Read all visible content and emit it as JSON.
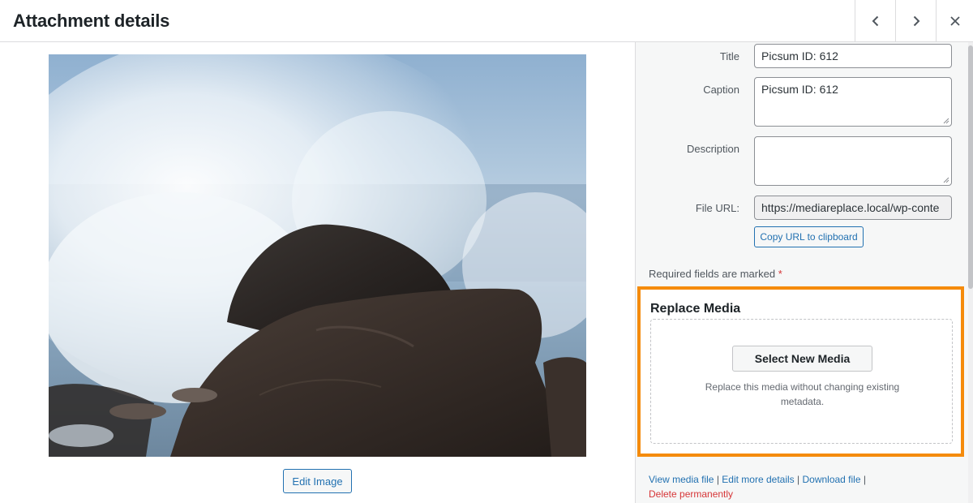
{
  "header": {
    "title": "Attachment details",
    "prev_icon": "chevron-left-icon",
    "next_icon": "chevron-right-icon",
    "close_icon": "close-icon"
  },
  "preview": {
    "image_icon": "ocean-wave-rock-photo",
    "edit_image_label": "Edit Image"
  },
  "fields": {
    "title_label": "Title",
    "title_value": "Picsum ID: 612",
    "caption_label": "Caption",
    "caption_value": "Picsum ID: 612",
    "description_label": "Description",
    "description_value": "",
    "file_url_label": "File URL:",
    "file_url_value": "https://mediareplace.local/wp-conte",
    "copy_url_label": "Copy URL to clipboard"
  },
  "required": {
    "text": "Required fields are marked",
    "star": "*"
  },
  "replace_media": {
    "title": "Replace Media",
    "button_label": "Select New Media",
    "description": "Replace this media without changing existing metadata.",
    "highlight_color": "#f58b0c"
  },
  "actions": {
    "view_label": "View media file",
    "edit_label": "Edit more details",
    "download_label": "Download file",
    "delete_label": "Delete permanently",
    "separator": "|"
  },
  "colors": {
    "link": "#2271b1",
    "danger": "#d63638",
    "sidebar_bg": "#f6f7f7"
  }
}
